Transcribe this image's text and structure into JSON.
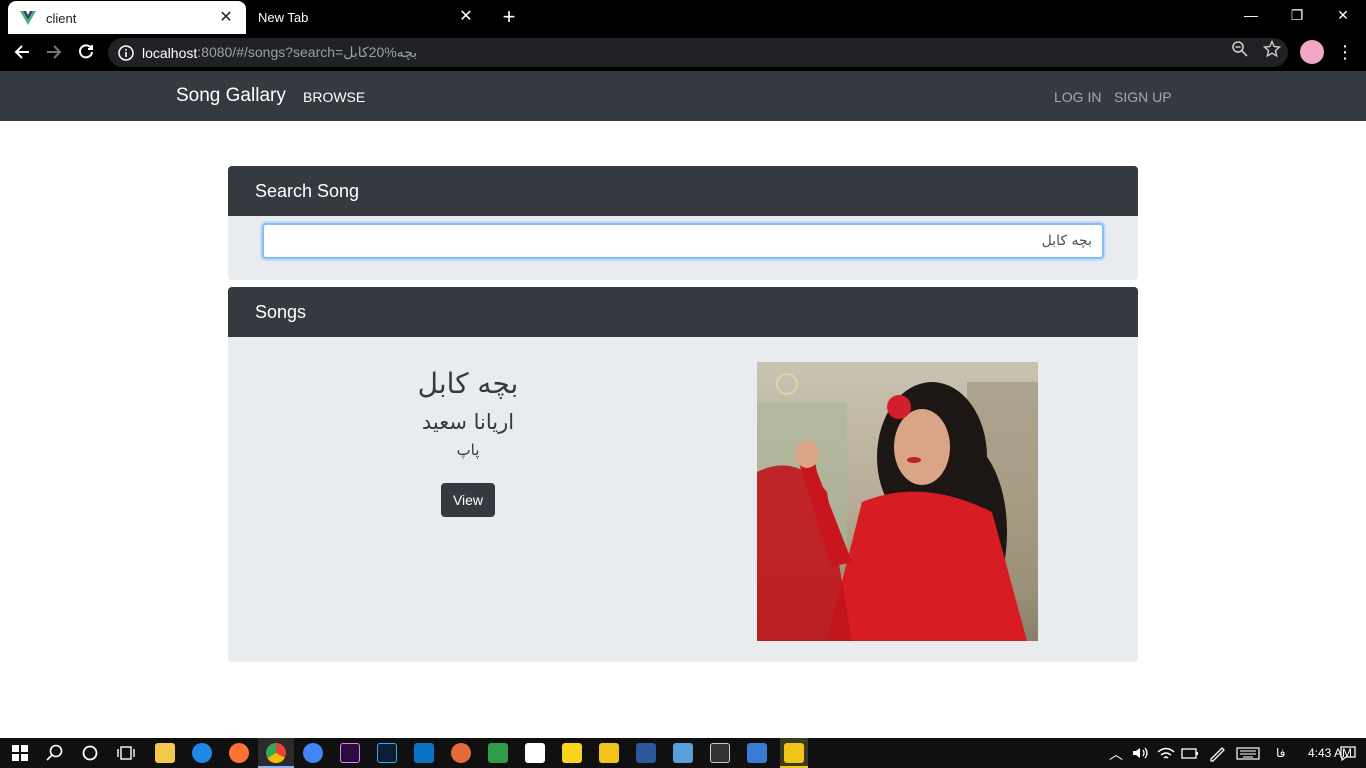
{
  "browser": {
    "tabs": [
      {
        "title": "client",
        "active": true
      },
      {
        "title": "New Tab",
        "active": false
      }
    ],
    "url_host": "localhost",
    "url_rest": ":8080/#/songs?search=بچه%20کابل"
  },
  "navbar": {
    "brand": "Song Gallary",
    "browse": "BROWSE",
    "login": "LOG IN",
    "signup": "SIGN UP"
  },
  "search": {
    "header": "Search Song",
    "value": "بچه کابل"
  },
  "songs": {
    "header": "Songs",
    "items": [
      {
        "title": "بچه کابل",
        "artist": "اریانا سعید",
        "genre": "پاپ",
        "view_label": "View"
      }
    ]
  },
  "taskbar": {
    "lang": "فا",
    "time": "4:43 AM"
  },
  "colors": {
    "navbar_bg": "#343a40",
    "panel_bg": "#e9ecef",
    "input_focus": "#80bdff"
  }
}
